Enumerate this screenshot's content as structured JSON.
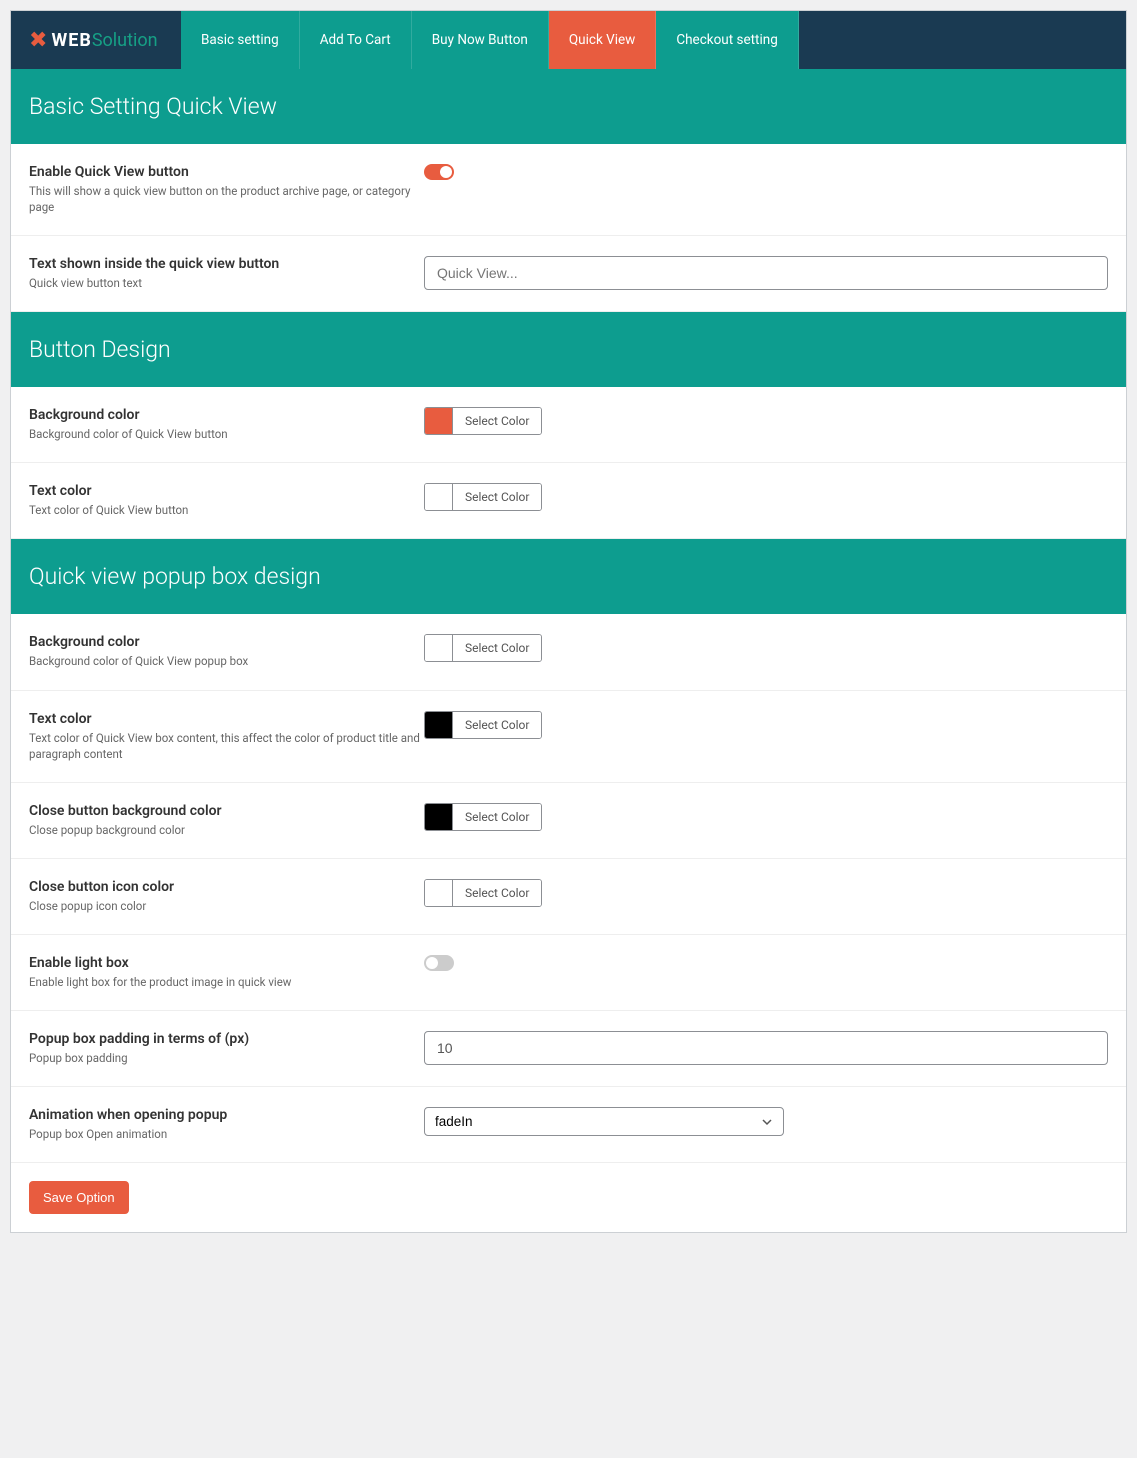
{
  "logo": {
    "web": "WEB",
    "sol": "Solution"
  },
  "tabs": [
    {
      "label": "Basic setting"
    },
    {
      "label": "Add To Cart"
    },
    {
      "label": "Buy Now Button"
    },
    {
      "label": "Quick View",
      "active": true
    },
    {
      "label": "Checkout setting"
    }
  ],
  "sections": {
    "basic": {
      "title": "Basic Setting Quick View",
      "enable": {
        "title": "Enable Quick View button",
        "desc": "This will show a quick view button on the product archive page, or category page"
      },
      "text": {
        "title": "Text shown inside the quick view button",
        "desc": "Quick view button text",
        "placeholder": "Quick View..."
      }
    },
    "design": {
      "title": "Button Design",
      "bg": {
        "title": "Background color",
        "desc": "Background color of Quick View button"
      },
      "tc": {
        "title": "Text color",
        "desc": "Text color of Quick View button"
      }
    },
    "popup": {
      "title": "Quick view popup box design",
      "bg": {
        "title": "Background color",
        "desc": "Background color of Quick View popup box"
      },
      "tc": {
        "title": "Text color",
        "desc": "Text color of Quick View box content, this affect the color of product title and paragraph content"
      },
      "closebg": {
        "title": "Close button background color",
        "desc": "Close popup background color"
      },
      "closeic": {
        "title": "Close button icon color",
        "desc": "Close popup icon color"
      },
      "lightbox": {
        "title": "Enable light box",
        "desc": "Enable light box for the product image in quick view"
      },
      "padding": {
        "title": "Popup box padding in terms of (px)",
        "desc": "Popup box padding",
        "value": "10"
      },
      "anim": {
        "title": "Animation when opening popup",
        "desc": "Popup box Open animation",
        "value": "fadeIn"
      }
    }
  },
  "select_color": "Select Color",
  "save": "Save Option",
  "colors": {
    "accent": "#e85c3f",
    "teal": "#0d9d8f"
  }
}
